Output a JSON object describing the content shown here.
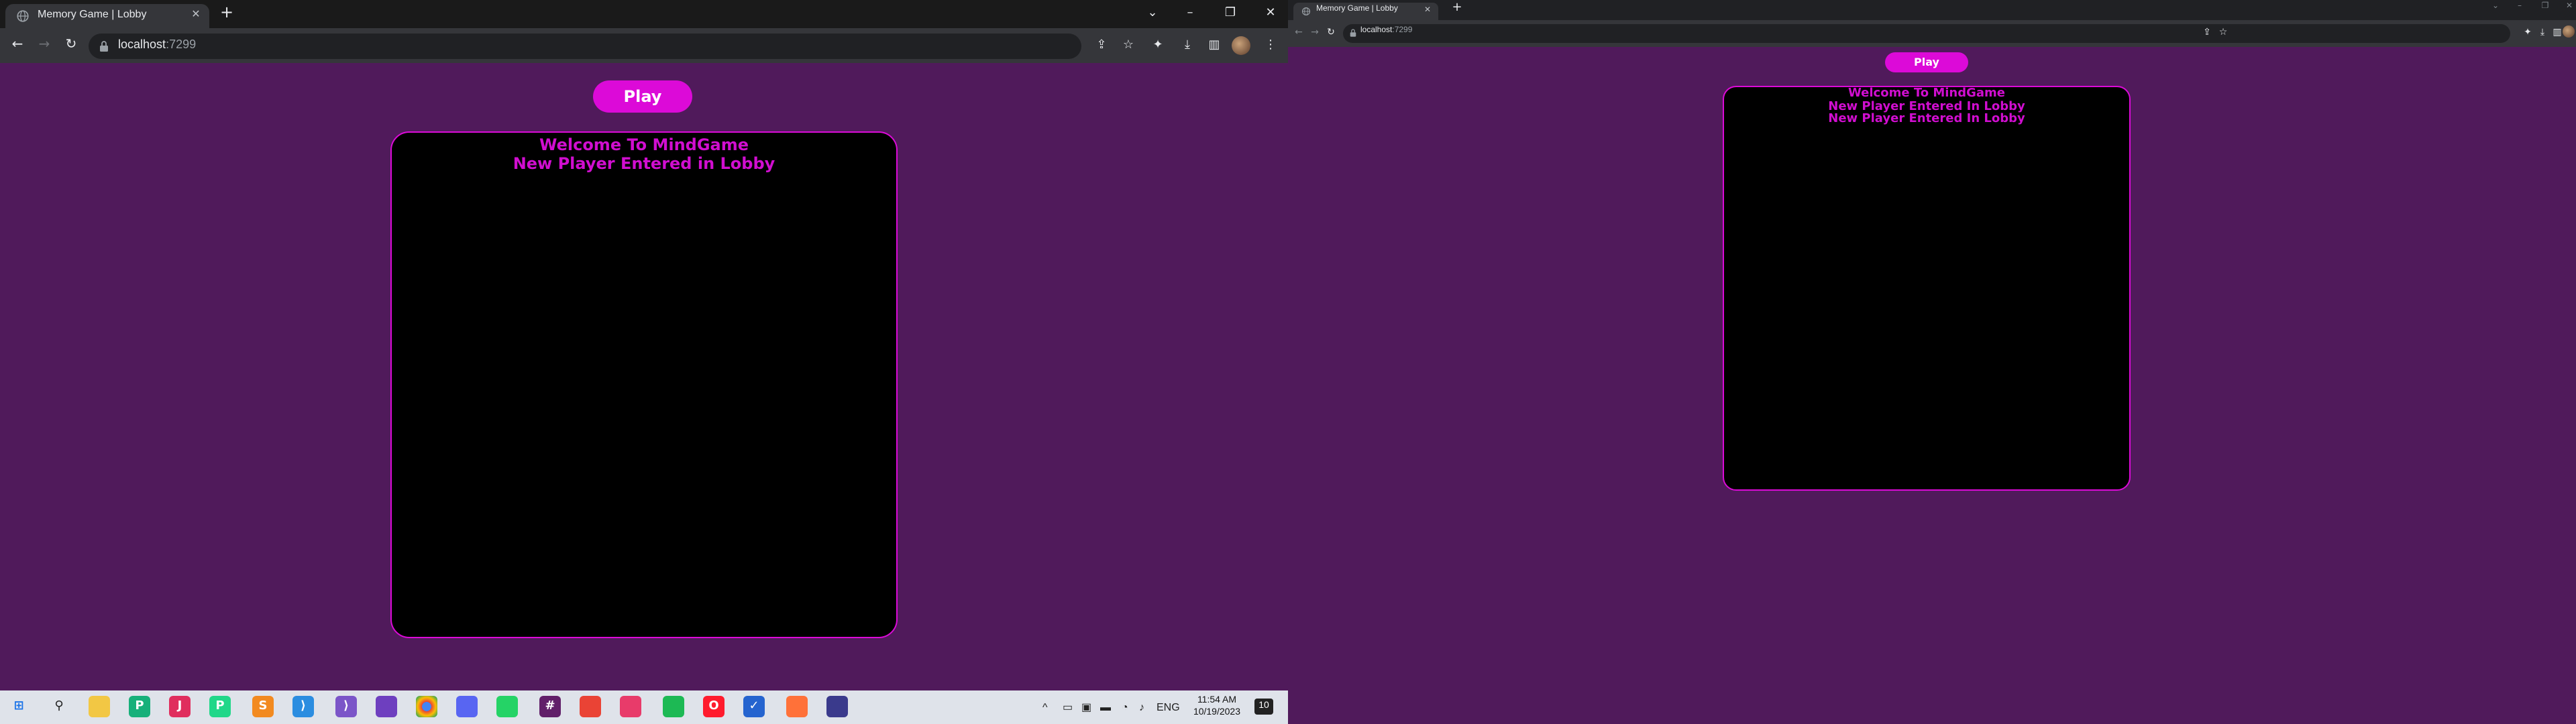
{
  "browser": {
    "tab_title": "Memory Game | Lobby",
    "url_host": "localhost",
    "url_port": ":7299"
  },
  "icons": {
    "favicon": "globe-icon",
    "close": "close-icon",
    "new_tab": "plus-icon",
    "back": "back-arrow-icon",
    "forward": "forward-arrow-icon",
    "reload": "reload-icon",
    "lock": "lock-icon",
    "share": "share-icon",
    "bookmark": "star-icon",
    "extensions": "puzzle-icon",
    "downloads": "download-icon",
    "side_panel": "side-panel-icon",
    "menu": "kebab-menu-icon"
  },
  "colors": {
    "page_background": "#501a5b",
    "accent": "#dc0ad8",
    "lobby_text": "#d10ed0",
    "lobby_background": "#000000"
  },
  "left_page": {
    "play_label": "Play",
    "messages": [
      "Welcome To MindGame",
      "New Player Entered in Lobby"
    ]
  },
  "right_page": {
    "play_label": "Play",
    "messages": [
      "Welcome To MindGame",
      "New Player Entered In Lobby",
      "New Player Entered In Lobby"
    ]
  },
  "taskbar": {
    "language": "ENG",
    "time": "11:54 AM",
    "date": "10/19/2023",
    "notification_count": "10",
    "apps": [
      "start",
      "search",
      "file-explorer",
      "pycharm",
      "jetbrains",
      "pycharm-ce",
      "sublime-text",
      "vscode",
      "visual-studio",
      "github-desktop",
      "chrome",
      "discord",
      "whatsapp",
      "slack",
      "app",
      "screen-recorder",
      "spotify",
      "opera",
      "todo",
      "firefox",
      "terminal"
    ]
  }
}
